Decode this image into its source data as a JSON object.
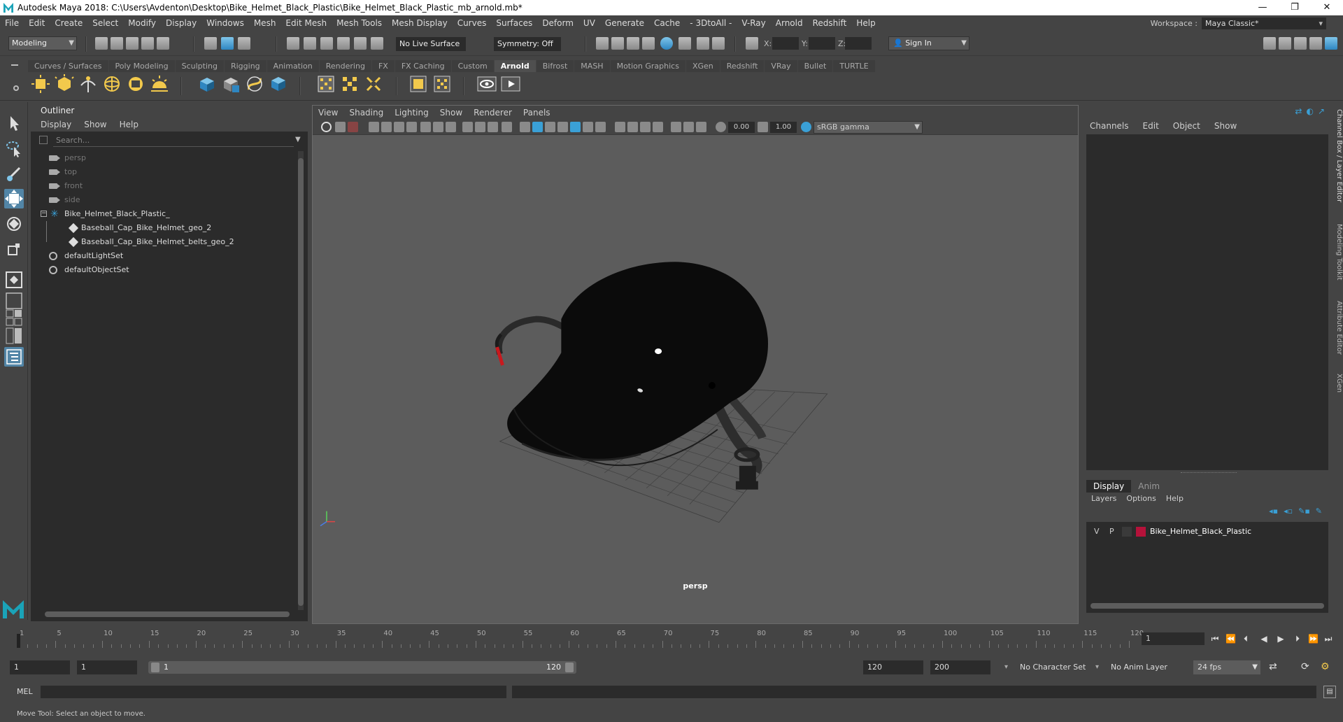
{
  "window": {
    "title": "Autodesk Maya 2018: C:\\Users\\Avdenton\\Desktop\\Bike_Helmet_Black_Plastic\\Bike_Helmet_Black_Plastic_mb_arnold.mb*",
    "minimize": "—",
    "restore": "❐",
    "close": "✕"
  },
  "menubar": {
    "items": [
      "File",
      "Edit",
      "Create",
      "Select",
      "Modify",
      "Display",
      "Windows",
      "Mesh",
      "Edit Mesh",
      "Mesh Tools",
      "Mesh Display",
      "Curves",
      "Surfaces",
      "Deform",
      "UV",
      "Generate",
      "Cache",
      "- 3DtoAll -",
      "V-Ray",
      "Arnold",
      "Redshift",
      "Help"
    ],
    "workspace_label": "Workspace :",
    "workspace_value": "Maya Classic*"
  },
  "statusline": {
    "mode": "Modeling",
    "live_surface": "No Live Surface",
    "symmetry": "Symmetry: Off",
    "x_label": "X:",
    "y_label": "Y:",
    "z_label": "Z:",
    "sign_in": "Sign In"
  },
  "shelf": {
    "tabs": [
      "Curves / Surfaces",
      "Poly Modeling",
      "Sculpting",
      "Rigging",
      "Animation",
      "Rendering",
      "FX",
      "FX Caching",
      "Custom",
      "Arnold",
      "Bifrost",
      "MASH",
      "Motion Graphics",
      "XGen",
      "Redshift",
      "VRay",
      "Bullet",
      "TURTLE"
    ],
    "active_tab": "Arnold"
  },
  "outliner": {
    "title": "Outliner",
    "menu": [
      "Display",
      "Show",
      "Help"
    ],
    "search_placeholder": "Search...",
    "items": [
      {
        "label": "persp",
        "type": "camera",
        "dim": true
      },
      {
        "label": "top",
        "type": "camera",
        "dim": true
      },
      {
        "label": "front",
        "type": "camera",
        "dim": true
      },
      {
        "label": "side",
        "type": "camera",
        "dim": true
      },
      {
        "label": "Bike_Helmet_Black_Plastic_",
        "type": "group",
        "dim": false
      },
      {
        "label": "Baseball_Cap_Bike_Helmet_geo_2",
        "type": "mesh",
        "dim": false
      },
      {
        "label": "Baseball_Cap_Bike_Helmet_belts_geo_2",
        "type": "mesh",
        "dim": false
      },
      {
        "label": "defaultLightSet",
        "type": "set",
        "dim": false
      },
      {
        "label": "defaultObjectSet",
        "type": "set",
        "dim": false
      }
    ]
  },
  "viewport": {
    "menu": [
      "View",
      "Shading",
      "Lighting",
      "Show",
      "Renderer",
      "Panels"
    ],
    "exposure": "0.00",
    "gamma": "1.00",
    "color_space": "sRGB gamma",
    "camera_label": "persp"
  },
  "channelbox": {
    "menu": [
      "Channels",
      "Edit",
      "Object",
      "Show"
    ],
    "layer_tabs": [
      "Display",
      "Anim"
    ],
    "layer_menu": [
      "Layers",
      "Options",
      "Help"
    ],
    "layer": {
      "v": "V",
      "p": "P",
      "name": "Bike_Helmet_Black_Plastic",
      "color": "#b5123a"
    },
    "side_tabs": [
      "Channel Box / Layer Editor",
      "Modeling Toolkit",
      "Attribute Editor",
      "XGen"
    ]
  },
  "timeline": {
    "ticks": [
      "1",
      "5",
      "10",
      "15",
      "20",
      "25",
      "30",
      "35",
      "40",
      "45",
      "50",
      "55",
      "60",
      "65",
      "70",
      "75",
      "80",
      "85",
      "90",
      "95",
      "100",
      "105",
      "110",
      "115",
      "120"
    ],
    "current_frame": "1"
  },
  "rangebar": {
    "start": "1",
    "playback_start": "1",
    "range_start": "1",
    "range_end": "120",
    "playback_end": "120",
    "end": "200",
    "character_set": "No Character Set",
    "anim_layer": "No Anim Layer",
    "fps": "24 fps"
  },
  "mel": {
    "label": "MEL"
  },
  "helpline": {
    "text": "Move Tool: Select an object to move."
  },
  "colors": {
    "accent": "#5285a6",
    "panel": "#444444",
    "field": "#2b2b2b",
    "viewport_bg": "#5c5c5c"
  }
}
